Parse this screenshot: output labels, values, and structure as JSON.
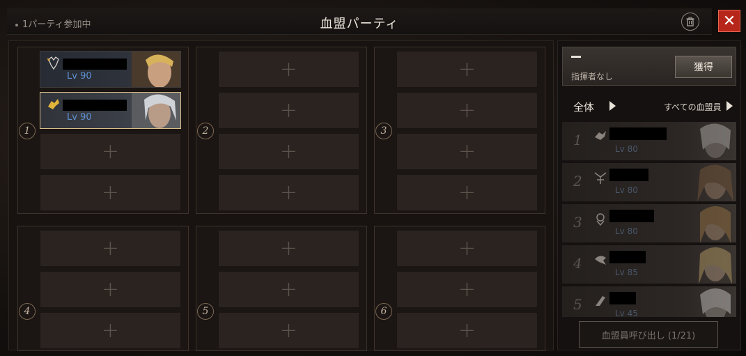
{
  "header": {
    "party_status": "1パーティ参加中",
    "title": "血盟パーティ",
    "close_label": "✕"
  },
  "parties": [
    {
      "number": "1",
      "members": [
        {
          "level": "Lv 90",
          "selected": false
        },
        {
          "level": "Lv 90",
          "selected": true
        }
      ],
      "empty_slots": 2
    },
    {
      "number": "2",
      "members": [],
      "empty_slots": 4
    },
    {
      "number": "3",
      "members": [],
      "empty_slots": 4
    },
    {
      "number": "4",
      "members": [],
      "empty_slots": 3
    },
    {
      "number": "5",
      "members": [],
      "empty_slots": 3
    },
    {
      "number": "6",
      "members": [],
      "empty_slots": 3
    }
  ],
  "slot_plus": "+",
  "leader": {
    "dash": "ー",
    "label": "指揮者なし",
    "acquire_button": "獲得"
  },
  "filter": {
    "label": "全体",
    "all_members_label": "すべての血盟員"
  },
  "clan_members": [
    {
      "rank": "1",
      "level": "Lv 80"
    },
    {
      "rank": "2",
      "level": "Lv 80"
    },
    {
      "rank": "3",
      "level": "Lv 80"
    },
    {
      "rank": "4",
      "level": "Lv 85"
    },
    {
      "rank": "5",
      "level": "Lv 45"
    }
  ],
  "summon_button": "血盟員呼び出し (1/21)",
  "colors": {
    "accent_gold": "#d9c08a",
    "level_blue": "#5f8fd0",
    "close_red": "#b7261a"
  }
}
